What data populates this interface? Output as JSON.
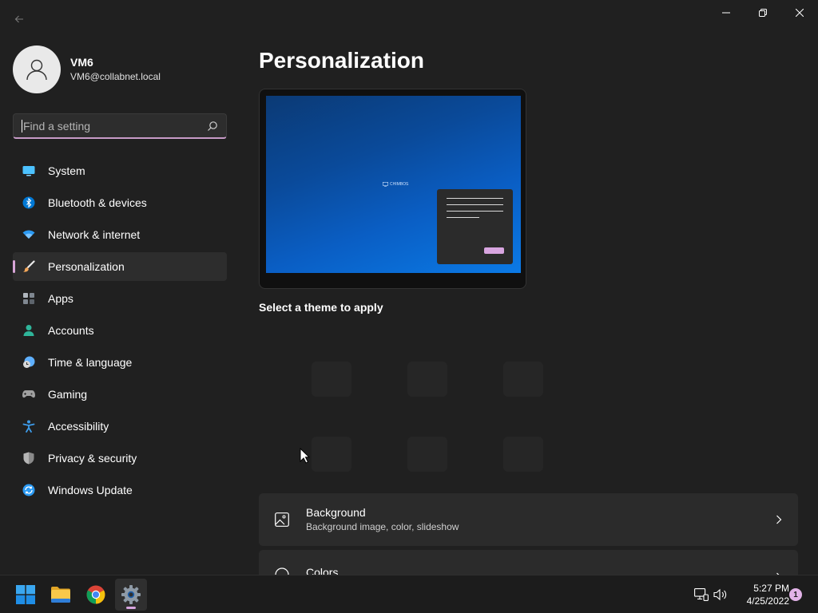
{
  "window": {
    "title": "Settings",
    "caption": {
      "minimize": "minimize",
      "maximize": "restore",
      "close": "close"
    }
  },
  "profile": {
    "name": "VM6",
    "email": "VM6@collabnet.local"
  },
  "search": {
    "placeholder": "Find a setting",
    "value": ""
  },
  "nav": {
    "items": [
      {
        "label": "System",
        "icon": "monitor-icon",
        "color": "#4cc2ff",
        "active": false
      },
      {
        "label": "Bluetooth & devices",
        "icon": "bluetooth-icon",
        "color": "#0078d4",
        "active": false
      },
      {
        "label": "Network & internet",
        "icon": "wifi-icon",
        "color": "#2b9af3",
        "active": false
      },
      {
        "label": "Personalization",
        "icon": "paintbrush-icon",
        "color": "#f2a65a",
        "active": true
      },
      {
        "label": "Apps",
        "icon": "apps-icon",
        "color": "#9aa0a6",
        "active": false
      },
      {
        "label": "Accounts",
        "icon": "person-icon",
        "color": "#2fb59a",
        "active": false
      },
      {
        "label": "Time & language",
        "icon": "clock-globe-icon",
        "color": "#5fb0ff",
        "active": false
      },
      {
        "label": "Gaming",
        "icon": "gamepad-icon",
        "color": "#a0a0a0",
        "active": false
      },
      {
        "label": "Accessibility",
        "icon": "accessibility-icon",
        "color": "#3d9be9",
        "active": false
      },
      {
        "label": "Privacy & security",
        "icon": "shield-icon",
        "color": "#8a8a8a",
        "active": false
      },
      {
        "label": "Windows Update",
        "icon": "sync-icon",
        "color": "#2b9af3",
        "active": false
      }
    ]
  },
  "main": {
    "title": "Personalization",
    "preview": {
      "logo_text": "CHIMBOS"
    },
    "theme_section_label": "Select a theme to apply",
    "cards": [
      {
        "title": "Background",
        "subtitle": "Background image, color, slideshow",
        "icon": "image-icon"
      },
      {
        "title": "Colors",
        "subtitle": "",
        "icon": "palette-icon"
      }
    ]
  },
  "taskbar": {
    "apps": [
      {
        "name": "Start",
        "icon": "windows-logo-icon",
        "active": false
      },
      {
        "name": "File Explorer",
        "icon": "folder-icon",
        "active": false
      },
      {
        "name": "Google Chrome",
        "icon": "chrome-icon",
        "active": false
      },
      {
        "name": "Settings",
        "icon": "gear-icon",
        "active": true
      }
    ],
    "tray": {
      "network_icon": "network-icon",
      "volume_icon": "speaker-icon"
    },
    "clock": {
      "time": "5:27 PM",
      "date": "4/25/2022"
    },
    "notifications": "1"
  },
  "colors": {
    "accent": "#d8a5e0",
    "background": "#202020",
    "card": "#2b2b2b"
  }
}
